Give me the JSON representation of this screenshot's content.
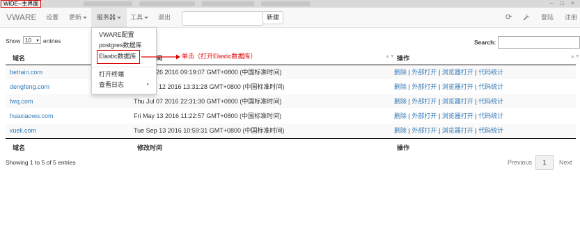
{
  "window": {
    "title": "WIDE--主界面"
  },
  "navbar": {
    "brand": "VWARE",
    "items": [
      "设置",
      "更新",
      "服务器",
      "工具",
      "退出"
    ],
    "search": {
      "value": "",
      "placeholder": ""
    },
    "new_button": "新建",
    "right": {
      "refresh_icon": "refresh-icon",
      "wrench_icon": "wrench-icon",
      "login": "登陆",
      "register": "注册"
    }
  },
  "dropdown": {
    "items": [
      "VWARE配置",
      "postgres数据库",
      "Elastic数据库",
      "打开终端",
      "查看日志"
    ],
    "highlighted": "Elastic数据库"
  },
  "annotation": {
    "text": "单击（打开Elastic数据库）",
    "color": "#e00000"
  },
  "table": {
    "length": {
      "prefix": "Show",
      "value": "10",
      "suffix": "entries"
    },
    "search_label": "Search:",
    "columns": [
      "域名",
      "修改时间",
      "操作"
    ],
    "rows": [
      {
        "domain": "betrain.com",
        "time": "26 2016 09:19:07 GMT+0800 (中国标准时间)"
      },
      {
        "domain": "dengfeng.com",
        "time": "12 2016 13:31:28 GMT+0800 (中国标准时间)"
      },
      {
        "domain": "fwq.com",
        "time": "Thu Jul 07 2016 22:31:30 GMT+0800 (中国标准时间)"
      },
      {
        "domain": "huaxiaowu.com",
        "time": "Fri May 13 2016 11:22:57 GMT+0800 (中国标准时间)"
      },
      {
        "domain": "xueli.com",
        "time": "Tue Sep 13 2016 10:59:31 GMT+0800 (中国标准时间)"
      }
    ],
    "actions": [
      "删除",
      "外部打开",
      "浏览器打开",
      "代码统计"
    ],
    "separator": "|",
    "info": "Showing 1 to 5 of 5 entries",
    "pagination": {
      "previous": "Previous",
      "page": "1",
      "next": "Next"
    }
  },
  "colors": {
    "link": "#337ab7",
    "annotation": "#e00000",
    "navbar_bg": "#f8f8f8"
  }
}
